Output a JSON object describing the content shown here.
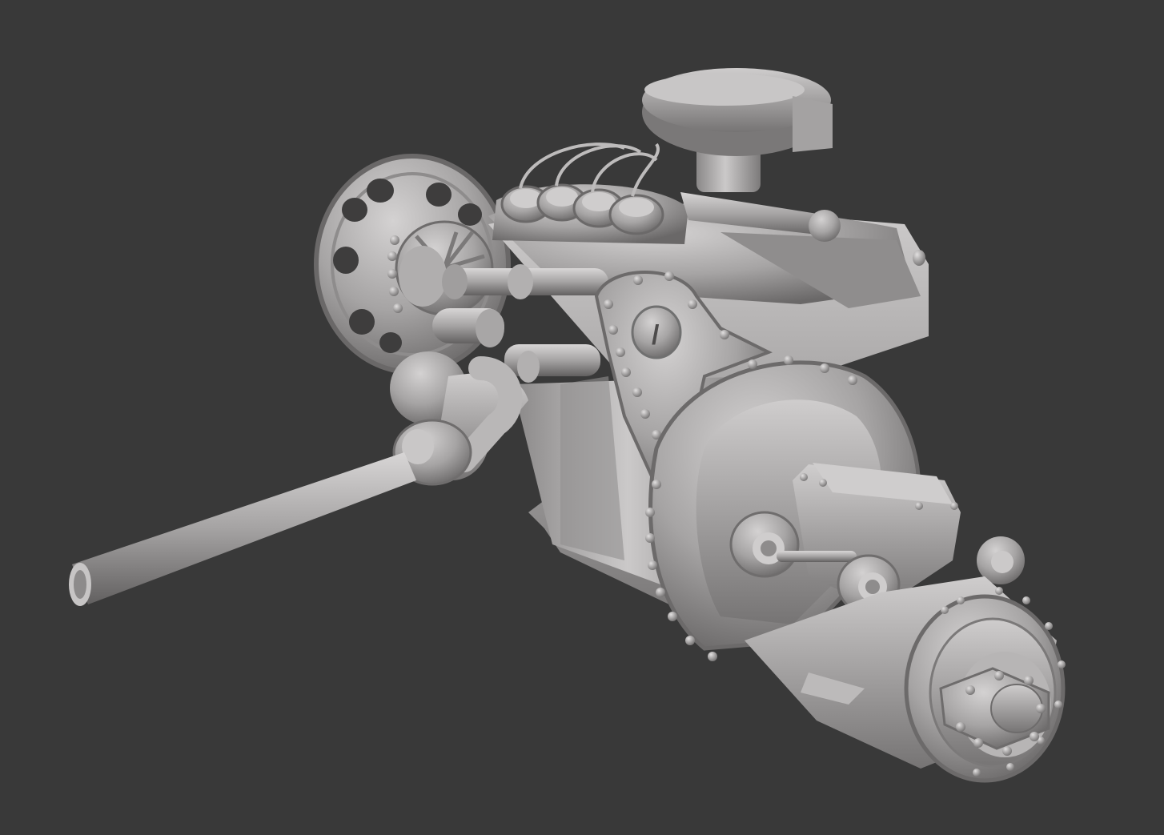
{
  "scene": {
    "subject": "engine-clay-render",
    "background_color": "#393939",
    "material_color": "#a9a7a7",
    "highlight_color": "#d2d0d0",
    "shadow_color": "#5d5b5b",
    "dial_glyph": "/"
  }
}
